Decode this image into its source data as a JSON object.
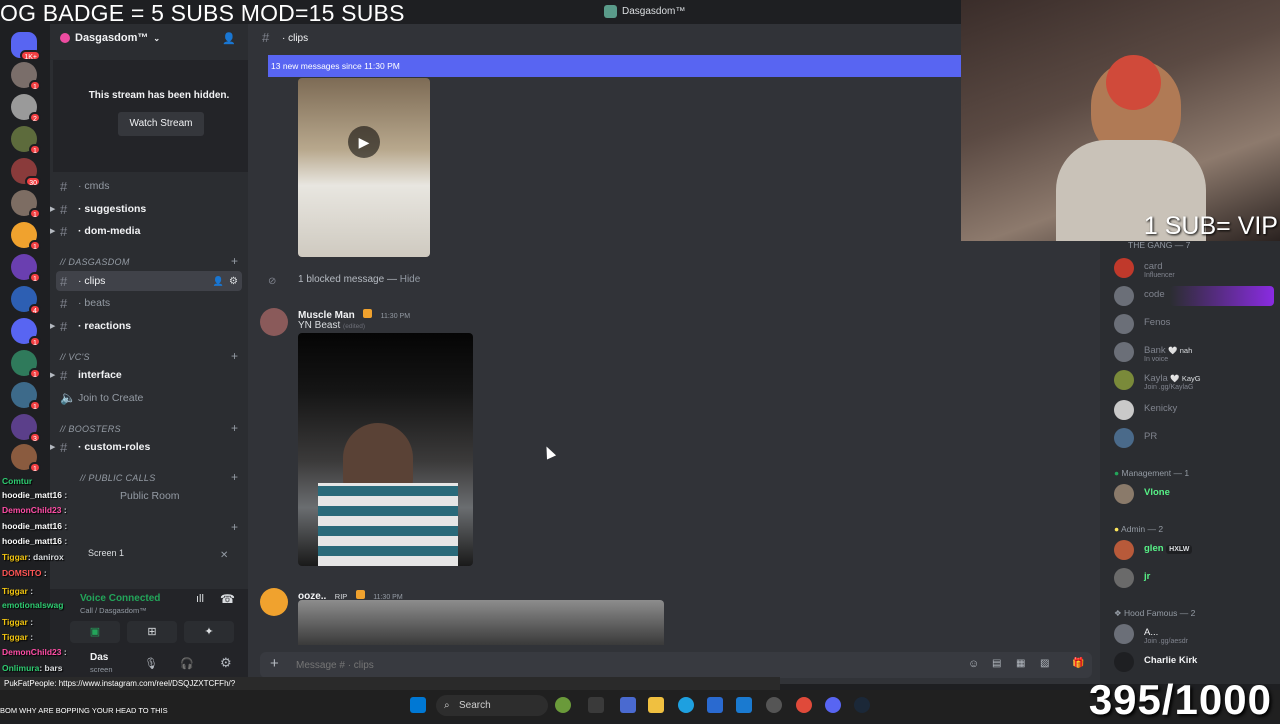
{
  "overlay": {
    "top_text": "OG BADGE = 5 SUBS   MOD=15 SUBS",
    "vip_text": "1 SUB= VIP",
    "sub_count": "395/1000"
  },
  "window": {
    "title": "Dasgasdom™"
  },
  "rail": {
    "badges": [
      "1K+",
      "1",
      "2",
      "1",
      "30",
      "1",
      "1",
      "1",
      "4",
      "1",
      "1",
      "1",
      "3",
      "1"
    ]
  },
  "sidebar": {
    "server_name": "Dasgasdom™",
    "stream_hidden": "This stream has been hidden.",
    "watch_stream": "Watch Stream",
    "channels": [
      {
        "name": "cmds",
        "prefix": "·",
        "unread": false
      },
      {
        "name": "suggestions",
        "prefix": "·",
        "unread": true
      },
      {
        "name": "dom-media",
        "prefix": "·",
        "unread": true
      },
      {
        "name": "clips",
        "prefix": "·",
        "unread": false
      },
      {
        "name": "beats",
        "prefix": "·",
        "unread": false
      },
      {
        "name": "reactions",
        "prefix": "·",
        "unread": true
      },
      {
        "name": "interface",
        "prefix": "",
        "unread": true
      },
      {
        "name": "Join to Create",
        "prefix": "",
        "unread": false
      },
      {
        "name": "custom-roles",
        "prefix": "·",
        "unread": true
      },
      {
        "name": "Public Room",
        "prefix": "",
        "unread": false
      }
    ],
    "categories": {
      "dasgasdom": "// DASGASDOM",
      "vcs": "// Vc's",
      "boosters": "// Boosters",
      "public_calls": "// PUBLIC CALLS"
    },
    "screen_label": "Screen 1",
    "voice_connected": "Voice Connected",
    "voice_sub": "Call / Dasgasdom™",
    "user_name": "Das",
    "user_status": "screen"
  },
  "chat_overlay": [
    {
      "user": "Comtur",
      "text": "",
      "color": "#2ecc71"
    },
    {
      "user": "hoodie_matt16",
      "text": ":",
      "color": "#ffffff"
    },
    {
      "user": "DemonChild23",
      "text": ":",
      "color": "#ff4da6"
    },
    {
      "user": "hoodie_matt16",
      "text": ":",
      "color": "#ffffff"
    },
    {
      "user": "hoodie_matt16",
      "text": ":",
      "color": "#ffffff"
    },
    {
      "user": "Tiggar",
      "text": ": danirox",
      "color": "#f1c40f"
    },
    {
      "user": "DOMSITO",
      "text": ":",
      "color": "#ff5555"
    },
    {
      "user": "Tiggar",
      "text": ":",
      "color": "#f1c40f"
    },
    {
      "user": "emotionalswag",
      "text": "",
      "color": "#2ecc71"
    },
    {
      "user": "Tiggar",
      "text": ":",
      "color": "#f1c40f"
    },
    {
      "user": "Tiggar",
      "text": ":",
      "color": "#f1c40f"
    },
    {
      "user": "DemonChild23",
      "text": ":",
      "color": "#ff4da6"
    },
    {
      "user": "Onlimura",
      "text": ": bars",
      "color": "#2ecc71"
    }
  ],
  "main": {
    "channel": "· clips",
    "new_messages": "13 new messages since 11:30 PM",
    "blocked": "1 blocked message —",
    "hide": "Hide",
    "messages": [
      {
        "author": "Muscle Man",
        "time": "11:30 PM",
        "text": "YN Beast",
        "edited": "(edited)"
      },
      {
        "author": "ooze..",
        "tag": "RIP",
        "time": "11:30 PM",
        "text": ""
      }
    ],
    "composer_placeholder": "Message # · clips"
  },
  "members": {
    "groups": [
      {
        "title": "THE GANG — 7",
        "items": [
          {
            "name": "card",
            "status": "Influencer"
          },
          {
            "name": "code",
            "status": ""
          },
          {
            "name": "Fenos",
            "status": ""
          },
          {
            "name": "Bank",
            "status": "nah",
            "sub": "In voice"
          },
          {
            "name": "Kayla",
            "status": "KayG",
            "sub": "Join .gg/KaylaG"
          },
          {
            "name": "Kenicky",
            "status": ""
          },
          {
            "name": "PR",
            "status": ""
          }
        ]
      },
      {
        "title": "Management — 1",
        "items": [
          {
            "name": "Vlone",
            "status": ""
          }
        ]
      },
      {
        "title": "Admin — 2",
        "items": [
          {
            "name": "glen",
            "status": "HXLW"
          },
          {
            "name": "jr",
            "status": ""
          }
        ]
      },
      {
        "title": "Hood Famous — 2",
        "items": [
          {
            "name": "A...",
            "status": "Join .gg/aesdr"
          },
          {
            "name": "Charlie Kirk",
            "status": ""
          }
        ]
      }
    ]
  },
  "ticker": {
    "line1": "PukFatPeople: https://www.instagram.com/reel/DSQJZXTCFFh/?",
    "line2": "BOM WHY ARE BOPPING YOUR HEAD TO THIS"
  },
  "taskbar": {
    "search": "Search"
  },
  "colors": {
    "blurple": "#5865f2",
    "online": "#23a55a",
    "mention": "#f23f42"
  }
}
